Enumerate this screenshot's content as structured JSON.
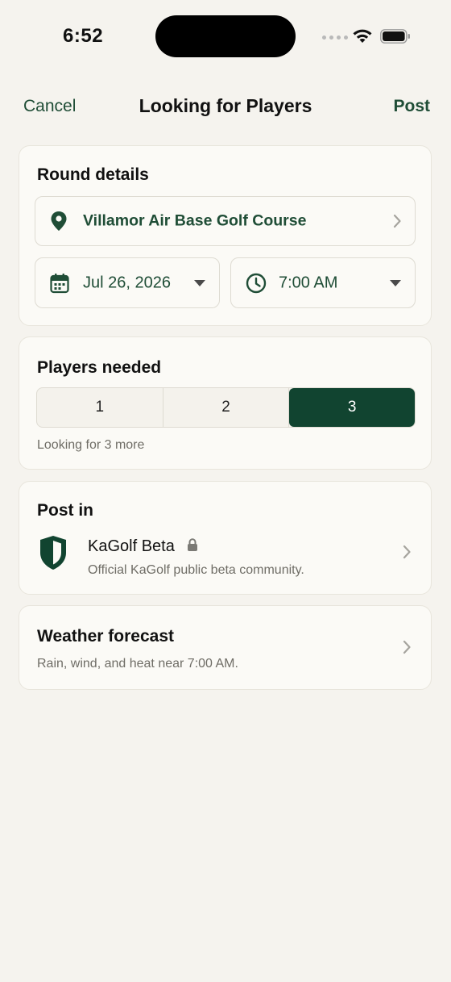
{
  "status_bar": {
    "time": "6:52"
  },
  "nav": {
    "cancel_label": "Cancel",
    "title": "Looking for Players",
    "post_label": "Post"
  },
  "round_details": {
    "title": "Round details",
    "course": "Villamor Air Base Golf Course",
    "date": "Jul 26, 2026",
    "time": "7:00 AM"
  },
  "players": {
    "title": "Players needed",
    "options": [
      "1",
      "2",
      "3"
    ],
    "selected": "3",
    "hint": "Looking for 3 more"
  },
  "post_in": {
    "title": "Post in",
    "community_name": "KaGolf Beta",
    "community_description": "Official KaGolf public beta community."
  },
  "weather": {
    "title": "Weather forecast",
    "description": "Rain, wind, and heat near 7:00 AM."
  },
  "colors": {
    "accent": "#1f4d36",
    "selected_segment": "#114430",
    "background": "#f5f3ee"
  }
}
